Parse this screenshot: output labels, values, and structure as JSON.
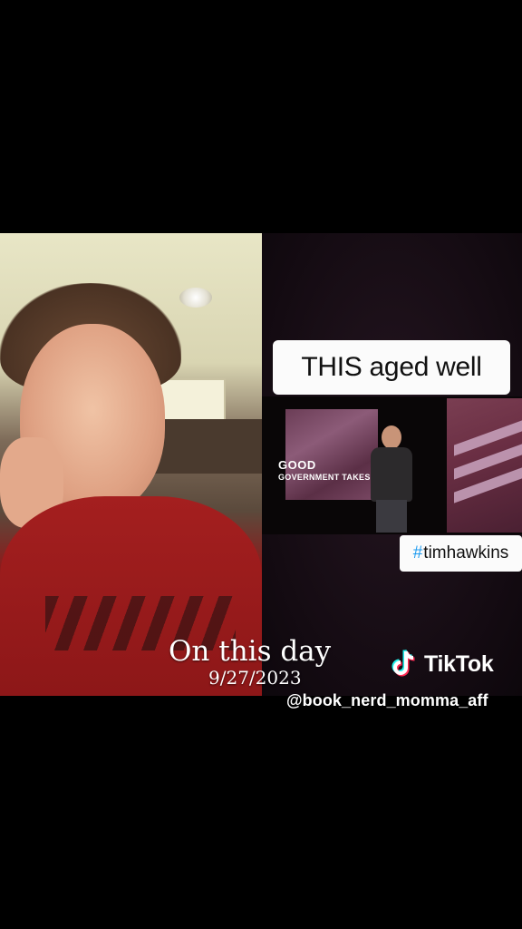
{
  "overlay": {
    "caption": "THIS aged well",
    "hashtag_symbol": "#",
    "hashtag_text": "timhawkins",
    "slide_title": "GOOD",
    "slide_subtitle": "GOVERNMENT TAKES"
  },
  "memory": {
    "title": "On this day",
    "date": "9/27/2023"
  },
  "branding": {
    "app_name": "TikTok",
    "logo_icon": "tiktok-note-icon",
    "username": "@book_nerd_momma_aff",
    "logo_colors": {
      "cyan": "#25F4EE",
      "red": "#FE2C55",
      "white": "#FFFFFF"
    }
  }
}
